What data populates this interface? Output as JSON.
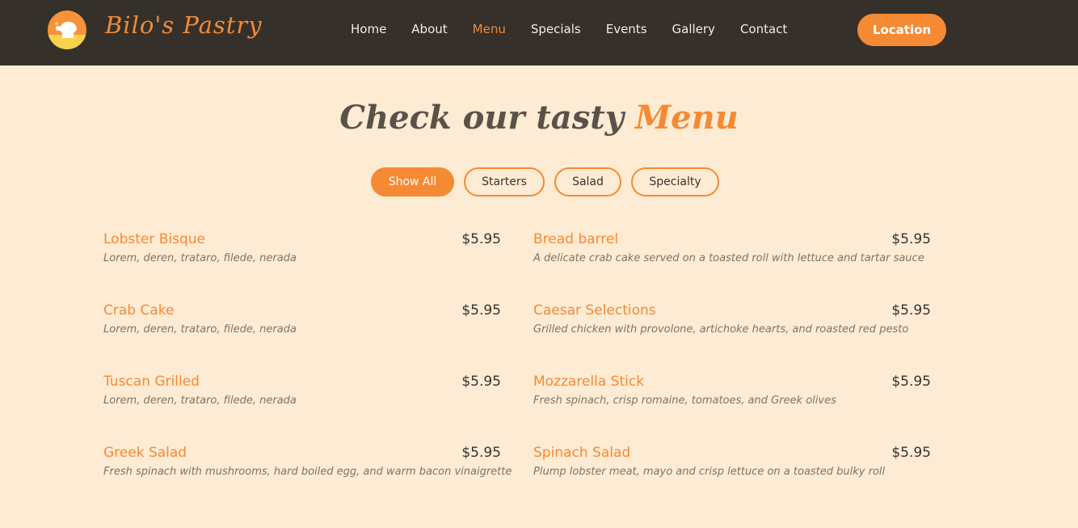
{
  "header": {
    "brand": "Bilo's Pastry",
    "nav": [
      "Home",
      "About",
      "Menu",
      "Specials",
      "Events",
      "Gallery",
      "Contact"
    ],
    "active_nav": "Menu",
    "location_label": "Location"
  },
  "section": {
    "title_main": "Check our tasty",
    "title_accent": "Menu"
  },
  "filters": [
    "Show All",
    "Starters",
    "Salad",
    "Specialty"
  ],
  "active_filter": "Show All",
  "menu": [
    {
      "name": "Lobster Bisque",
      "price": "$5.95",
      "desc": "Lorem, deren, trataro, filede, nerada"
    },
    {
      "name": "Bread barrel",
      "price": "$5.95",
      "desc": "A delicate crab cake served on a toasted roll with lettuce and tartar sauce"
    },
    {
      "name": "Crab Cake",
      "price": "$5.95",
      "desc": "Lorem, deren, trataro, filede, nerada"
    },
    {
      "name": "Caesar Selections",
      "price": "$5.95",
      "desc": "Grilled chicken with provolone, artichoke hearts, and roasted red pesto"
    },
    {
      "name": "Tuscan Grilled",
      "price": "$5.95",
      "desc": "Lorem, deren, trataro, filede, nerada"
    },
    {
      "name": "Mozzarella Stick",
      "price": "$5.95",
      "desc": "Fresh spinach, crisp romaine, tomatoes, and Greek olives"
    },
    {
      "name": "Greek Salad",
      "price": "$5.95",
      "desc": "Fresh spinach with mushrooms, hard boiled egg, and warm bacon vinaigrette"
    },
    {
      "name": "Spinach Salad",
      "price": "$5.95",
      "desc": "Plump lobster meat, mayo and crisp lettuce on a toasted bulky roll"
    }
  ],
  "colors": {
    "header_bg": "#35302a",
    "page_bg": "#feebd3",
    "accent": "#f58a34"
  }
}
